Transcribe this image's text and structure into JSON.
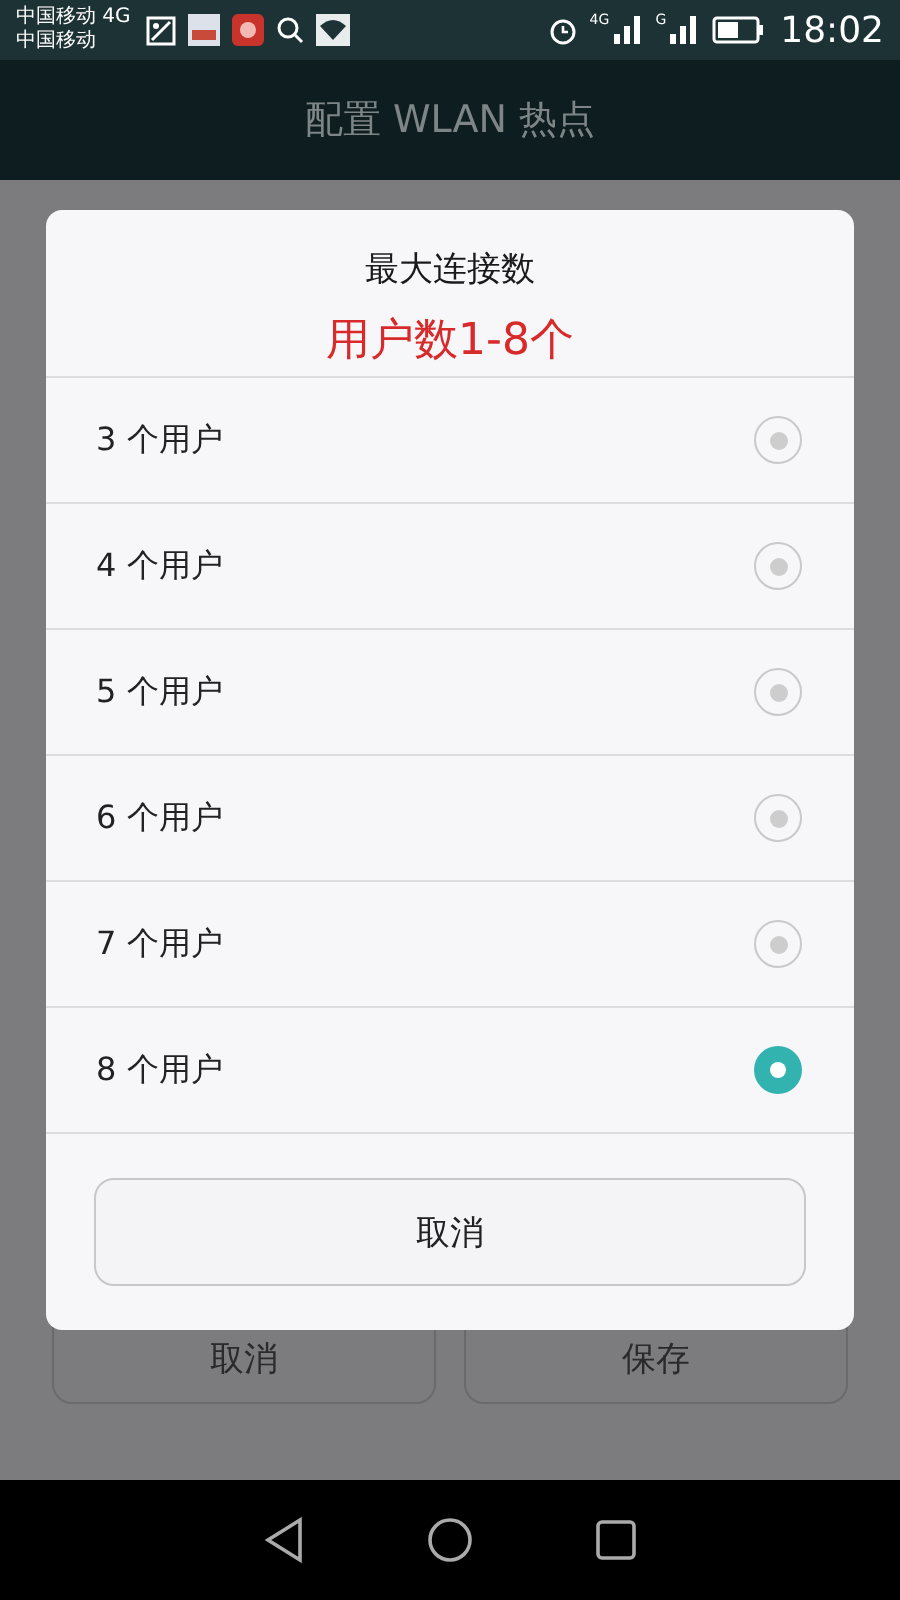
{
  "status_bar": {
    "carrier_lines": [
      "中国移动 4G",
      "中国移动"
    ],
    "network_labels": [
      "4G",
      "G"
    ],
    "time": "18:02"
  },
  "app_bar": {
    "title": "配置 WLAN 热点"
  },
  "background_buttons": [
    "取消",
    "保存"
  ],
  "dialog": {
    "title": "最大连接数",
    "annotation": "用户数1-8个",
    "options": [
      {
        "label": "3 个用户",
        "selected": false
      },
      {
        "label": "4 个用户",
        "selected": false
      },
      {
        "label": "5 个用户",
        "selected": false
      },
      {
        "label": "6 个用户",
        "selected": false
      },
      {
        "label": "7 个用户",
        "selected": false
      },
      {
        "label": "8 个用户",
        "selected": true
      }
    ],
    "cancel": "取消"
  }
}
